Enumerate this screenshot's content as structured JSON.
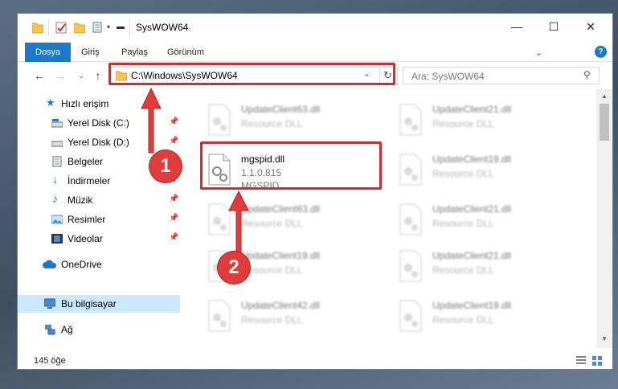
{
  "window": {
    "title": "SysWOW64",
    "controls": {
      "minimize": "—",
      "maximize": "☐",
      "close": "✕"
    }
  },
  "ribbon": {
    "tabs": [
      "Dosya",
      "Giriş",
      "Paylaş",
      "Görünüm"
    ],
    "help_icon": "?"
  },
  "navigation": {
    "address": "C:\\Windows\\SysWOW64",
    "search_placeholder": "Ara: SysWOW64"
  },
  "sidebar": {
    "items": [
      {
        "label": "Hızlı erişim",
        "icon": "star-icon"
      },
      {
        "label": "Yerel Disk (C:)",
        "icon": "drive-icon",
        "pinned": true
      },
      {
        "label": "Yerel Disk (D:)",
        "icon": "drive-icon",
        "pinned": true
      },
      {
        "label": "Belgeler",
        "icon": "documents-icon",
        "pinned": true
      },
      {
        "label": "İndirmeler",
        "icon": "download-icon",
        "pinned": true
      },
      {
        "label": "Müzik",
        "icon": "music-icon",
        "pinned": true
      },
      {
        "label": "Resimler",
        "icon": "pictures-icon",
        "pinned": true
      },
      {
        "label": "Videolar",
        "icon": "video-icon",
        "pinned": true
      },
      {
        "label": "OneDrive",
        "icon": "cloud-icon"
      },
      {
        "label": "Bu bilgisayar",
        "icon": "computer-icon",
        "selected": true
      },
      {
        "label": "Ağ",
        "icon": "network-icon"
      }
    ]
  },
  "files": [
    {
      "name": "UpdateClient63.dll",
      "line2": "Resource DLL",
      "blurred": true
    },
    {
      "name": "UpdateClient21.dll",
      "line2": "Resource DLL",
      "blurred": true
    },
    {
      "name": "mgspid.dll",
      "line2": "1.1.0.815",
      "line3": "MGSPID",
      "blurred": false
    },
    {
      "name": "UpdateClient19.dll",
      "line2": "Resource DLL",
      "blurred": true
    },
    {
      "name": "UpdateClient63.dll",
      "line2": "Resource DLL",
      "blurred": true
    },
    {
      "name": "UpdateClient21.dll",
      "line2": "Resource DLL",
      "blurred": true
    },
    {
      "name": "UpdateClient19.dll",
      "line2": "Resource DLL",
      "blurred": true
    },
    {
      "name": "UpdateClient21.dll",
      "line2": "Resource DLL",
      "blurred": true
    },
    {
      "name": "UpdateClient42.dll",
      "line2": "Resource DLL",
      "blurred": true
    },
    {
      "name": "UpdateClient19.dll",
      "line2": "Resource DLL",
      "blurred": true
    }
  ],
  "status": {
    "item_count": "145 öğe"
  },
  "annotations": {
    "badge1": "1",
    "badge2": "2"
  },
  "colors": {
    "accent": "#1979ca",
    "highlight": "#d22c2c",
    "selected": "#cce8ff"
  }
}
